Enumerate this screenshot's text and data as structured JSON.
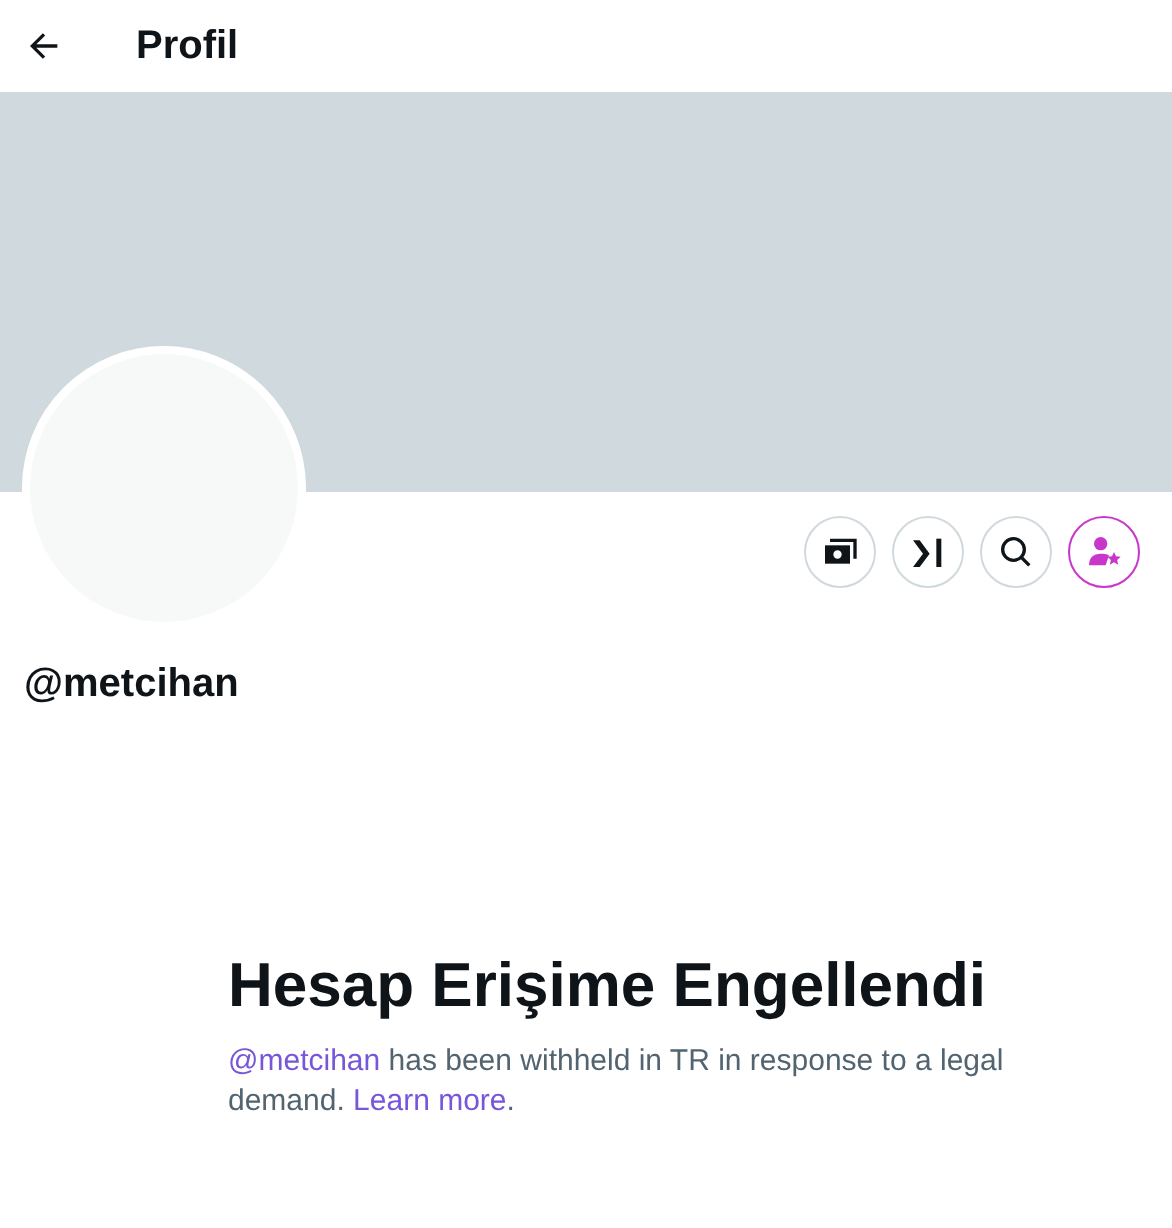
{
  "header": {
    "title": "Profil"
  },
  "profile": {
    "handle": "@metcihan"
  },
  "notice": {
    "title": "Hesap Erişime Engellendi",
    "mention": "@metcihan",
    "text": " has been withheld in TR in response to a legal demand. ",
    "link": "Learn more",
    "end": "."
  }
}
